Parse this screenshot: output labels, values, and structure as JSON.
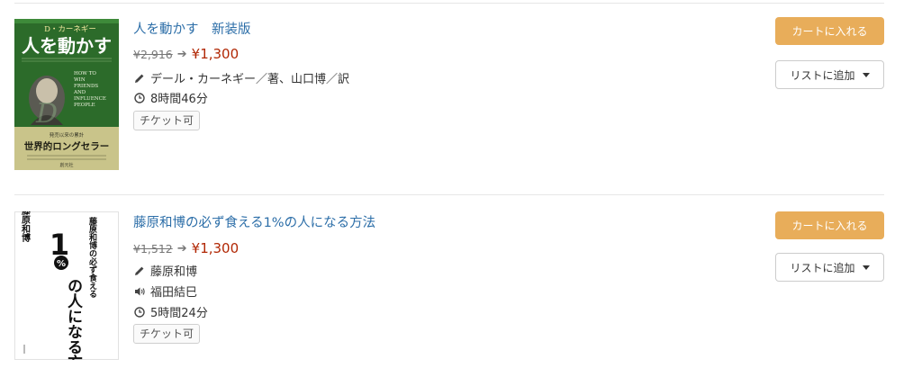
{
  "books": [
    {
      "title": "人を動かす　新装版",
      "old_price": "¥2,916",
      "new_price": "¥1,300",
      "author": "デール・カーネギー／著、山口博／訳",
      "duration": "8時間46分",
      "ticket": "チケット可",
      "cart_label": "カートに入れる",
      "list_label": "リストに追加",
      "cover": {
        "author_line": "D・カーネギー",
        "title": "人を動かす",
        "english": [
          "HOW TO",
          "WIN",
          "FRIENDS",
          "AND",
          "INFLUENCE",
          "PEOPLE"
        ],
        "band_small": "発売以来の累計",
        "band_big": "世界的ロングセラー",
        "publisher": "創元社"
      }
    },
    {
      "title": "藤原和博の必ず食える1%の人になる方法",
      "old_price": "¥1,512",
      "new_price": "¥1,300",
      "author": "藤原和博",
      "narrator": "福田結巳",
      "duration": "5時間24分",
      "ticket": "チケット可",
      "cart_label": "カートに入れる",
      "list_label": "リストに追加",
      "cover": {
        "author": "藤原和博",
        "subtitle": "藤原和博の必ず食える",
        "num": "1",
        "pct": "%",
        "title_rest": "の人になる方法"
      }
    }
  ],
  "colors": {
    "link": "#2c6ea8",
    "price": "#b12704",
    "cart_button": "#e8ad5a",
    "cover1_green": "#2c6b2a",
    "cover1_band": "#c9c48a"
  },
  "icons": {
    "arrow": "arrow-right-icon",
    "author": "pencil-icon",
    "narrator": "speaker-icon",
    "duration": "clock-icon",
    "dropdown": "caret-down-icon"
  }
}
